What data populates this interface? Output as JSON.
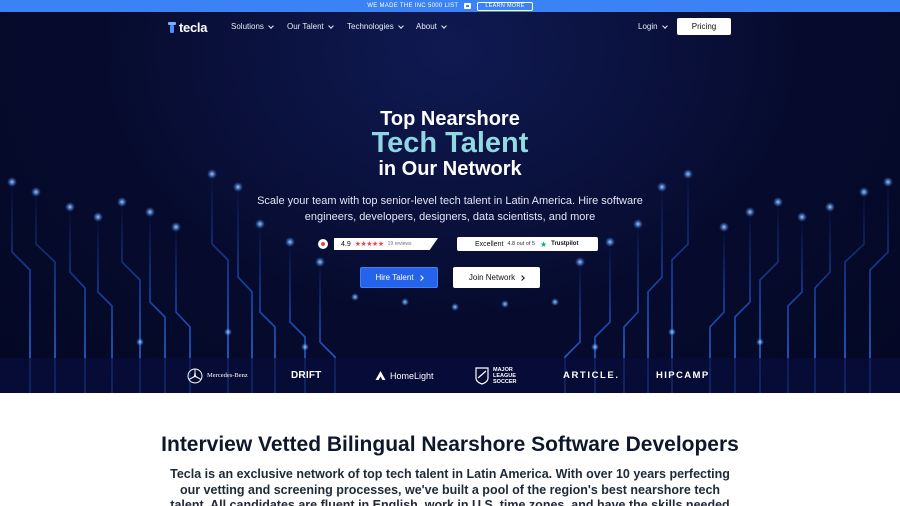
{
  "announcement": {
    "text": "WE MADE THE INC 5000 LIST",
    "button": "LEARN MORE"
  },
  "nav": {
    "brand": "tecla",
    "items": [
      {
        "label": "Solutions"
      },
      {
        "label": "Our Talent"
      },
      {
        "label": "Technologies"
      },
      {
        "label": "About"
      }
    ],
    "login": "Login",
    "pricing": "Pricing"
  },
  "hero": {
    "line1": "Top Nearshore",
    "line2": "Tech Talent",
    "line3": "in Our Network",
    "subtitle": "Scale your team with top senior-level tech talent in Latin America. Hire software engineers, developers, designers, data scientists, and more",
    "clutch": {
      "rating": "4.9",
      "stars": "★★★★★",
      "reviews": "19 reviews"
    },
    "trustpilot": {
      "label": "Excellent",
      "score": "4.8 out of 5",
      "name": "Trustpilot"
    },
    "cta_primary": "Hire Talent",
    "cta_secondary": "Join Network"
  },
  "clients": {
    "mercedes": "Mercedes-Benz",
    "drift": "DRIFT",
    "homelight": "HomeLight",
    "mls_line1": "MAJOR",
    "mls_line2": "LEAGUE",
    "mls_line3": "SOCCER",
    "article": "ARTICLE.",
    "hipcamp": "HIPCAMP"
  },
  "section": {
    "title": "Interview Vetted Bilingual Nearshore Software Developers",
    "body": "Tecla is an exclusive network of top tech talent in Latin America. With over 10 years perfecting our vetting and screening processes, we've built a pool of the region's best nearshore tech talent. All candidates are fluent in English, work in U.S. time zones, and have the skills needed in"
  },
  "colors": {
    "announce_bg": "#3b82f6",
    "hero_bg": "#060b2e",
    "accent": "#2563eb",
    "headline_gradient_start": "#7ac6f3",
    "headline_gradient_end": "#a8ead0"
  }
}
